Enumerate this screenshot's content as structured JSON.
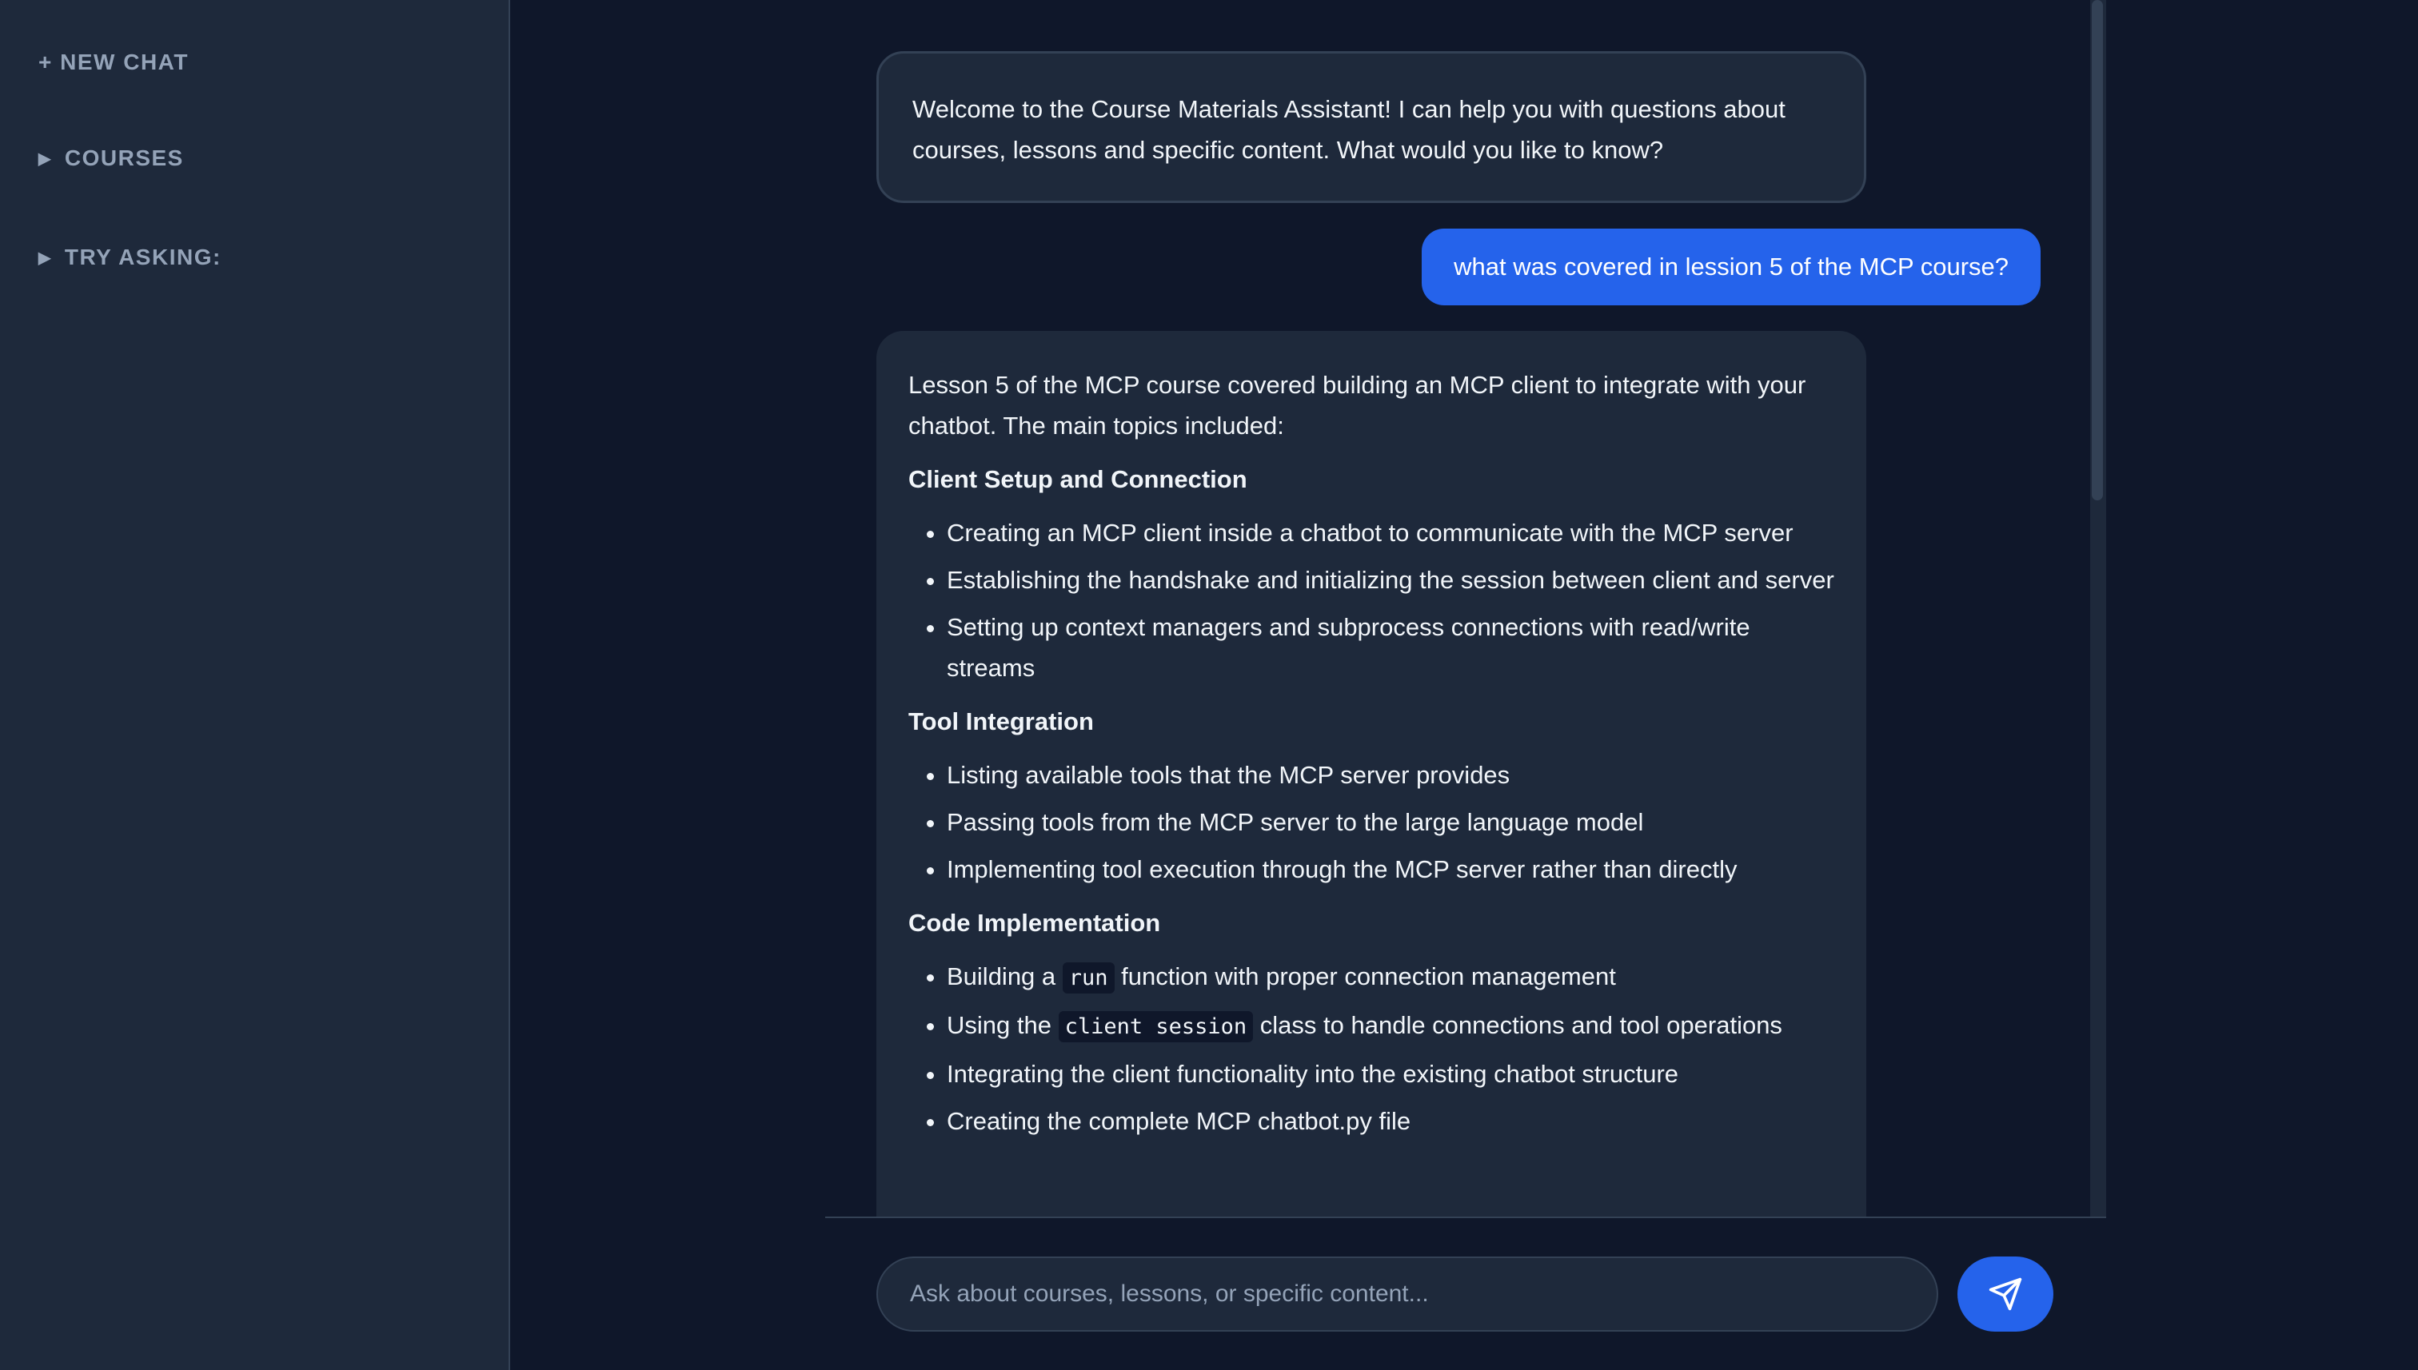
{
  "sidebar": {
    "new_chat": "+ NEW CHAT",
    "courses": "COURSES",
    "try_asking": "TRY ASKING:"
  },
  "chat": {
    "welcome": "Welcome to the Course Materials Assistant! I can help you with questions about courses, lessons and specific content. What would you like to know?",
    "user_message": "what was covered in lession 5 of the MCP course?",
    "answer": {
      "intro": "Lesson 5 of the MCP course covered building an MCP client to integrate with your chatbot. The main topics included:",
      "section1_heading": "Client Setup and Connection",
      "section1_items": [
        "Creating an MCP client inside a chatbot to communicate with the MCP server",
        "Establishing the handshake and initializing the session between client and server",
        "Setting up context managers and subprocess connections with read/write streams"
      ],
      "section2_heading": "Tool Integration",
      "section2_items": [
        "Listing available tools that the MCP server provides",
        "Passing tools from the MCP server to the large language model",
        "Implementing tool execution through the MCP server rather than directly"
      ],
      "section3_heading": "Code Implementation",
      "section3_items": [
        {
          "before": "Building a ",
          "code": "run",
          "after": " function with proper connection management"
        },
        {
          "before": "Using the ",
          "code": "client session",
          "after": " class to handle connections and tool operations"
        },
        {
          "before": "Integrating the client functionality into the existing chatbot structure",
          "code": "",
          "after": ""
        },
        {
          "before": "Creating the complete MCP chatbot.py file",
          "code": "",
          "after": ""
        }
      ]
    }
  },
  "input": {
    "placeholder": "Ask about courses, lessons, or specific content..."
  },
  "icons": {
    "send": "send-icon",
    "collapse": "triangle-right-icon"
  },
  "colors": {
    "background": "#0f172a",
    "surface": "#1e293b",
    "accent": "#2563eb",
    "border": "#334155",
    "muted_text": "#94a3b8"
  }
}
